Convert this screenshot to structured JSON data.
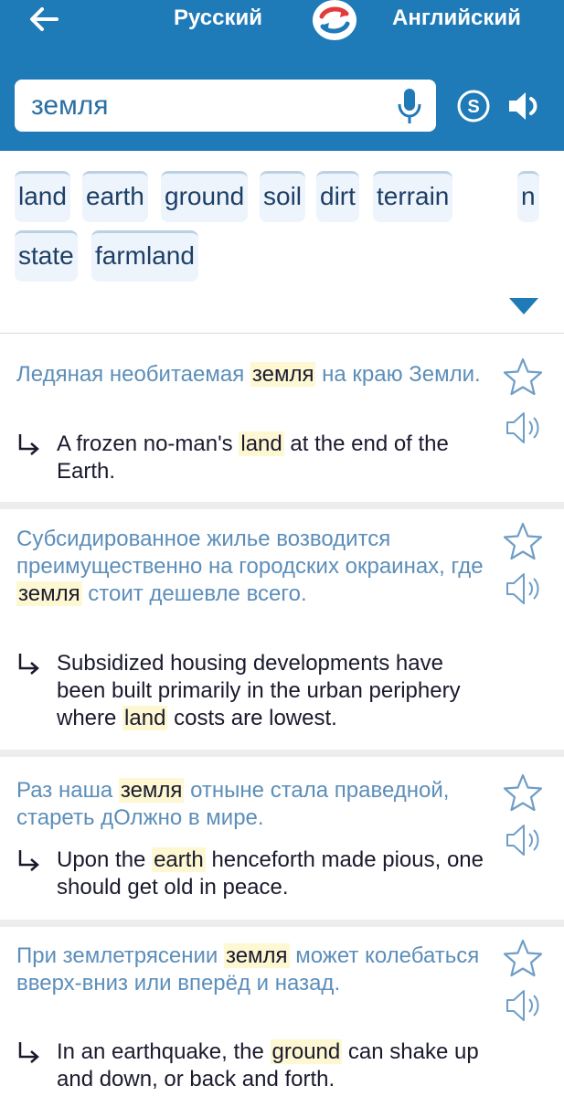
{
  "header": {
    "source_lang": "Русский",
    "target_lang": "Английский",
    "accent_color": "#1f7ab8"
  },
  "search": {
    "query": "земля",
    "icons": [
      "microphone-icon",
      "s-icon",
      "speaker-icon"
    ]
  },
  "chips": [
    "land",
    "earth",
    "ground",
    "soil",
    "dirt",
    "terrain",
    "n",
    "state",
    "farmland"
  ],
  "examples": [
    {
      "ru": [
        "Ледяная необитаемая ",
        "земля",
        " на краю Земли."
      ],
      "en": [
        "A frozen no-man's ",
        "land",
        " at the end of the Earth."
      ]
    },
    {
      "ru": [
        "Субсидированное жилье возводится преимущественно на городских окраинах, где ",
        "земля",
        " стоит дешевле всего."
      ],
      "en": [
        "Subsidized housing developments have been built primarily in the urban periphery where ",
        "land",
        " costs are lowest."
      ]
    },
    {
      "ru": [
        "Раз наша ",
        "земля",
        " отныне стала праведной, стареть дОлжно в мире."
      ],
      "en": [
        "Upon the ",
        "earth",
        " henceforth made pious, one should get old in peace."
      ]
    },
    {
      "ru": [
        "При землетрясении ",
        "земля",
        " может колебаться вверх-вниз или вперёд и назад."
      ],
      "en": [
        "In an earthquake, the ",
        "ground",
        " can shake up and down, or back and forth."
      ]
    }
  ]
}
